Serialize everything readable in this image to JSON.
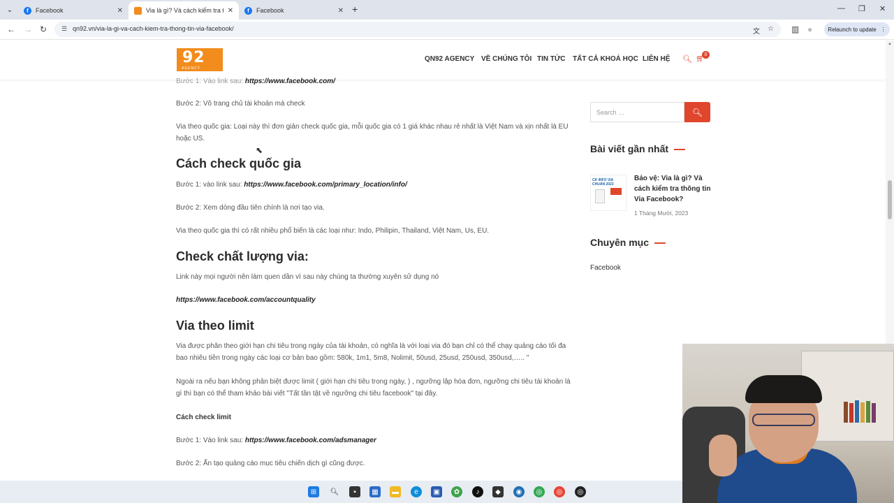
{
  "browser": {
    "tabs": [
      {
        "label": "Facebook"
      },
      {
        "label": "Via là gì? Và cách kiểm tra thông tin Via Facebook?"
      },
      {
        "label": "Facebook"
      }
    ],
    "url": "qn92.vn/via-la-gi-va-cach-kiem-tra-thong-tin-via-facebook/",
    "relaunch_label": "Relaunch to update"
  },
  "site": {
    "logo_big": "92",
    "logo_small": "AGENCY",
    "menu": [
      "QN92 AGENCY",
      "VỀ CHÚNG TÔI",
      "TIN TỨC",
      "TẤT CẢ KHOÁ HỌC",
      "LIÊN HỆ"
    ],
    "cart_count": "0"
  },
  "article": {
    "p1_prefix": "Bước 1: Vào link sau: ",
    "p1_link": "https://www.facebook.com/",
    "p2": "Bước 2: Vô trang chủ tài khoản mà check",
    "p3": "Via theo quốc gia: Loại này thì đơn giản check quốc gia, mỗi quốc gia có 1 giá khác nhau rẻ nhất là Việt Nam và xịn nhất là EU hoặc US.",
    "h_country": "Cách check quốc gia",
    "p4_prefix": "Bước 1:  vào link sau: ",
    "p4_link": "https://www.facebook.com/primary_location/info/",
    "p5": "Bước 2: Xem dòng đầu tiên chính là nơi tạo via.",
    "p6": "Via theo quốc gia thì có rất nhiều phổ biến là các loại như: Indo, Philipin, Thailand, Việt Nam, Us, EU.",
    "h_quality": "Check chất lượng via:",
    "p7": "Link này mọi người nên làm quen dần vì sau này chúng ta thường xuyên sử dụng nó",
    "p8_link": "https://www.facebook.com/accountquality",
    "h_limit": "Via theo limit",
    "p9": "Via được phân theo giới hạn chi tiêu trong ngày của tài khoản, có nghĩa là với loại via đó bạn chỉ có thể chạy quảng cáo tối đa bao nhiêu tiền trong ngày các loại cơ bản bao gồm: 580k, 1m1, 5m8, Nolimit, 50usd, 25usd, 250usd, 350usd,….. \"",
    "p10": "Ngoài ra nếu bạn không phân biệt được limit ( giới hạn chi tiêu trong ngày, ) , ngưỡng lập hóa đơn, ngưỡng chi tiêu tài khoản là gì thì bạn có thể tham khảo bài viết \"Tất tần tật về ngưỡng chi tiêu facebook\" tại đây.",
    "p11": "Cách check limit",
    "p12_prefix": "Bước 1: Vào link sau: ",
    "p12_link": "https://www.facebook.com/adsmanager",
    "p13": "Bước 2: Ấn tạo quảng cáo mục tiêu chiến dịch gì cũng được."
  },
  "sidebar": {
    "search_placeholder": "Search …",
    "recent_title": "Bài viết gần nhất",
    "post_title": "Bảo vệ: Via là gì? Và cách kiểm tra thông tin Via Facebook?",
    "post_date": "1 Tháng Mười, 2023",
    "thumb_text": "CK INFO VIA CHUẨN 2023",
    "category_title": "Chuyên mục",
    "category_item": "Facebook"
  },
  "colors": {
    "accent": "#e0462c",
    "brand_orange": "#f28c1c",
    "fb_blue": "#1877f2"
  }
}
